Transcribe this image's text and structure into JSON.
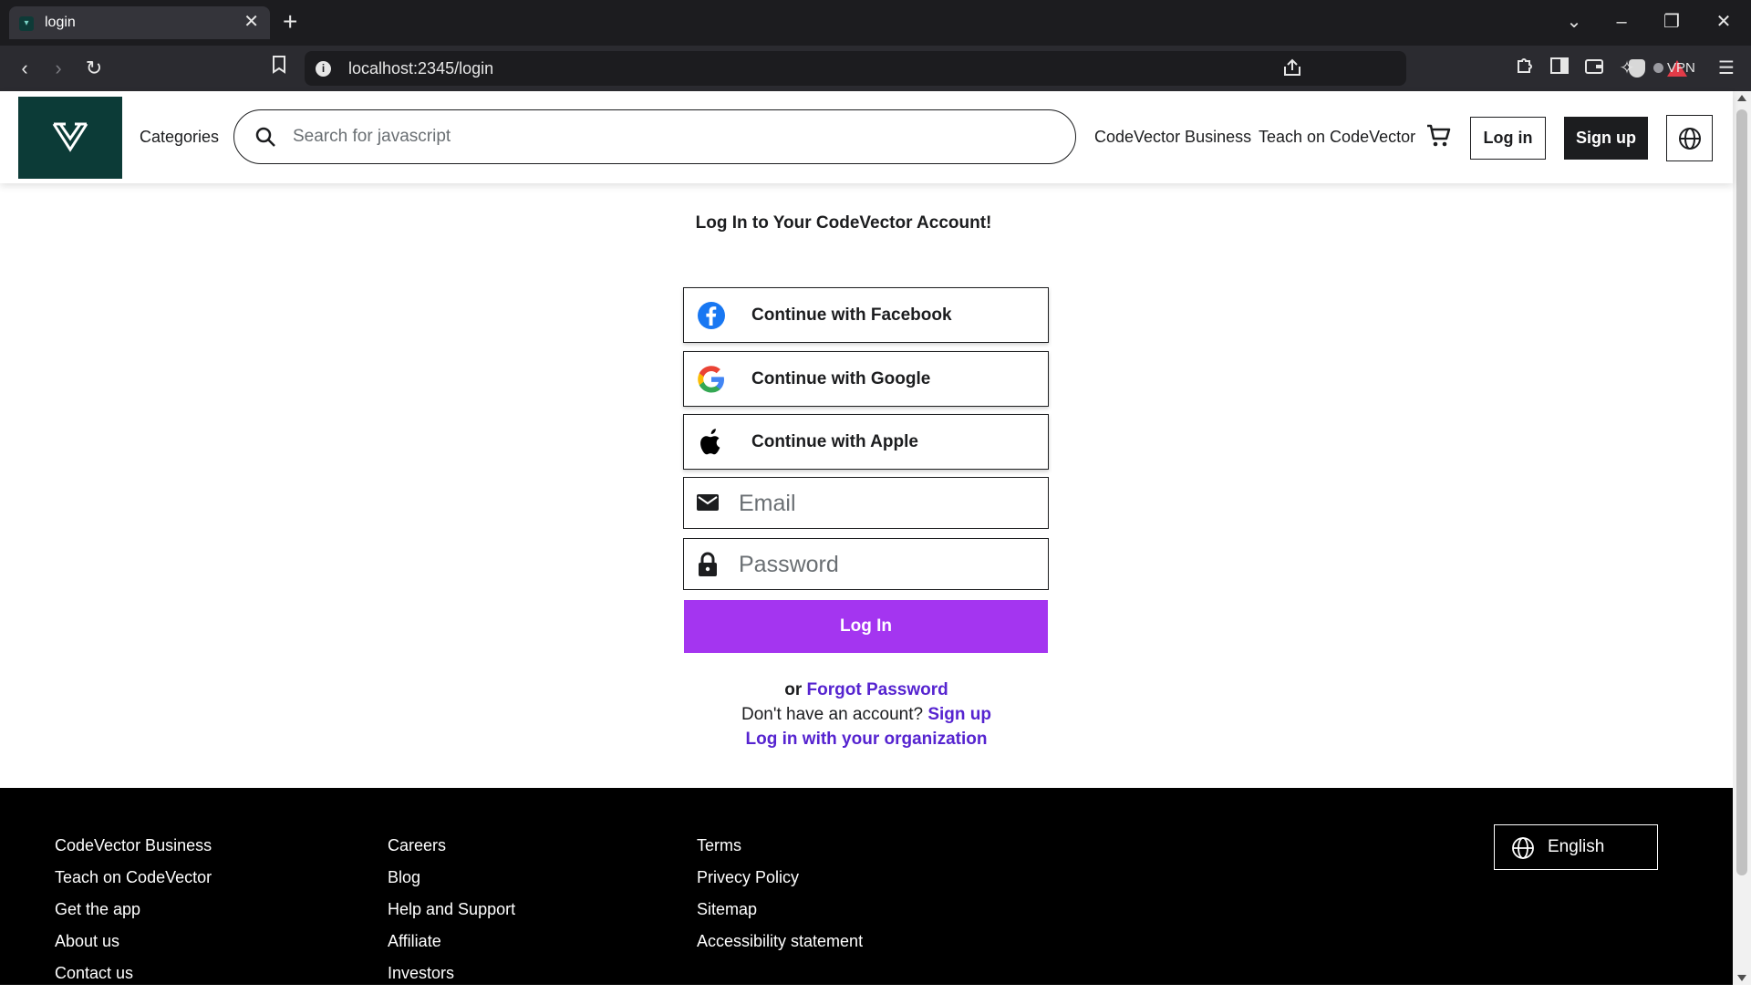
{
  "browser": {
    "tab_title": "login",
    "tab_close": "✕",
    "new_tab": "+",
    "url": "localhost:2345/login",
    "vpn_label": "VPN",
    "icons": [
      "back-icon",
      "forward-icon",
      "reload-icon",
      "bookmark-icon",
      "site-info-icon",
      "share-icon",
      "brave-shields-icon",
      "brave-rewards-icon",
      "extensions-icon",
      "sidebar-icon",
      "wallet-icon",
      "leo-ai-icon",
      "menu-icon"
    ]
  },
  "header": {
    "categories": "Categories",
    "search_placeholder": "Search for javascript",
    "business": "CodeVector Business",
    "teach": "Teach on CodeVector",
    "login": "Log in",
    "signup": "Sign up"
  },
  "login": {
    "title": "Log In to Your CodeVector Account!",
    "facebook": "Continue with Facebook",
    "google": "Continue with Google",
    "apple": "Continue with Apple",
    "email_placeholder": "Email",
    "password_placeholder": "Password",
    "submit": "Log In",
    "or": "or",
    "forgot": "Forgot Password",
    "no_account": "Don't have an account?",
    "signup": "Sign up",
    "organization": "Log in with your organization"
  },
  "footer": {
    "col1": [
      "CodeVector Business",
      "Teach on CodeVector",
      "Get the app",
      "About us",
      "Contact us"
    ],
    "col2": [
      "Careers",
      "Blog",
      "Help and Support",
      "Affiliate",
      "Investors"
    ],
    "col3": [
      "Terms",
      "Privecy Policy",
      "Sitemap",
      "Accessibility statement"
    ],
    "language": "English"
  },
  "colors": {
    "brand_dark": "#0c3b37",
    "accent_purple": "#a435f0",
    "link_purple": "#5624d0",
    "facebook_blue": "#1877f2"
  }
}
